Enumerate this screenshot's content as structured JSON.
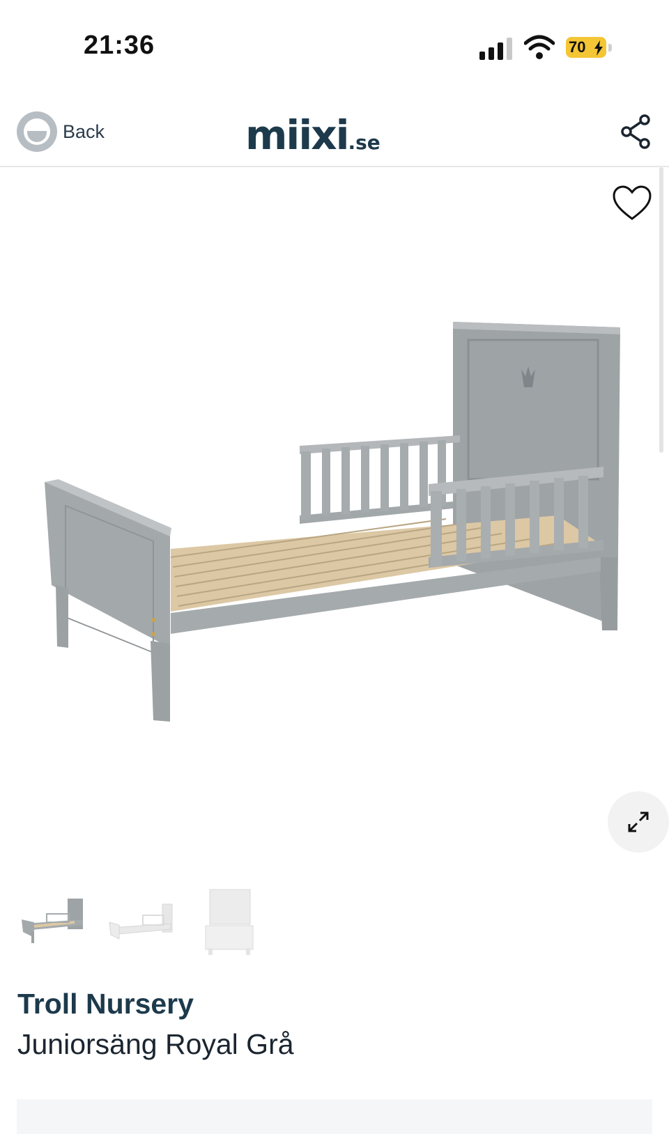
{
  "status_bar": {
    "time": "21:36",
    "battery": "70",
    "icons": [
      "signal-icon",
      "wifi-icon",
      "battery-charging-icon"
    ],
    "battery_color": "#f4c534"
  },
  "header": {
    "back_label": "Back",
    "logo_main": "miixi",
    "logo_tld": ".se",
    "brand_color": "#1d3a4c",
    "icons": [
      "back-icon",
      "share-icon"
    ]
  },
  "gallery": {
    "icons": [
      "heart-icon",
      "expand-icon"
    ],
    "thumbnail_count_visible": 3
  },
  "product": {
    "brand": "Troll Nursery",
    "name": "Juniorsäng Royal Grå"
  }
}
